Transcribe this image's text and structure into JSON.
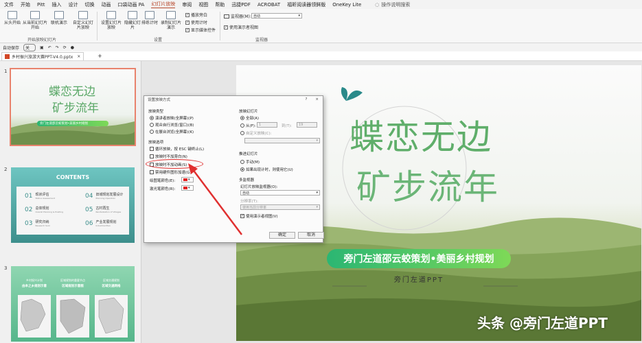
{
  "menu": {
    "items": [
      "文件",
      "开始",
      "Pitt",
      "插入",
      "设计",
      "切换",
      "动画",
      "口袋动画 PA",
      "幻灯片放映",
      "审阅",
      "视图",
      "帮助",
      "迅捷PDF",
      "ACROBAT",
      "福昕阅读器领鲜版",
      "OneKey Lite"
    ],
    "active_index": 8,
    "search": "操作说明搜索"
  },
  "ribbon": {
    "buttons": [
      "从头开始",
      "从当前幻灯片开始",
      "联机演示",
      "自定义幻灯片放映",
      "设置幻灯片放映",
      "隐藏幻灯片",
      "排练计时",
      "录制幻灯片演示"
    ],
    "groups": [
      "开始放映幻灯片",
      "设置",
      "监视器"
    ],
    "checks": [
      "播放旁白",
      "使用计时",
      "显示媒体控件"
    ],
    "monitor_label": "监视器(M):",
    "monitor_value": "自动",
    "presenter_view": "使用演示者视图"
  },
  "qat": {
    "autosave": "自动保存",
    "state": "关"
  },
  "file_tab": {
    "name": "乡村振兴旅游大赛PPT-V4.0.pptx"
  },
  "thumbs": {
    "numbers": [
      "1",
      "2",
      "3"
    ],
    "s1": {
      "title1": "蝶恋无边",
      "title2": "矿步流年",
      "banner": "旁门左道邵云蛟策划•美丽乡村规划"
    },
    "s2": {
      "title": "CONTENTS",
      "items": [
        {
          "num": "01",
          "label": "现状评估",
          "sub": "Status Assessment"
        },
        {
          "num": "02",
          "label": "总体规划",
          "sub": "Overall Planning & Positing"
        },
        {
          "num": "03",
          "label": "研究归纳",
          "sub": "Research Sum"
        },
        {
          "num": "04",
          "label": "旧城规划发展设计",
          "sub": "Planning Operation"
        },
        {
          "num": "05",
          "label": "古村再生",
          "sub": "Revitalization of Villages"
        },
        {
          "num": "06",
          "label": "产业发展规划",
          "sub": "Industrial Plan"
        }
      ]
    },
    "s3": {
      "headers": [
        "乡村振兴计划",
        "区域规划的重要节点",
        "区域交通规划"
      ],
      "subheaders": [
        "由本之乡规划示意",
        "区域规划示意图",
        "区域交通网络"
      ]
    }
  },
  "slide": {
    "title1": "蝶恋无边",
    "title2": "矿步流年",
    "banner": "旁门左道邵云蛟策划•美丽乡村规划",
    "subtitle": "旁门左道PPT"
  },
  "dialog": {
    "title": "设置放映方式",
    "help": "?",
    "close": "×",
    "show_type_label": "放映类型",
    "show_types": [
      "演讲者放映(全屏幕)(P)",
      "观众自行浏览(窗口)(B)",
      "在展台浏览(全屏幕)(K)"
    ],
    "options_label": "放映选项",
    "options": [
      "循环放映，按 ESC 键终止(L)",
      "放映时不加旁白(N)",
      "放映时不加动画(S)",
      "禁用硬件图形加速(G)"
    ],
    "pen_color_label": "绘图笔颜色(E):",
    "laser_color_label": "激光笔颜色(R):",
    "slides_label": "放映幻灯片",
    "all": "全部(A)",
    "from": "从(F):",
    "from_value": "1",
    "to": "到(T):",
    "to_value": "19",
    "custom_show": "自定义放映(C):",
    "advance_label": "推进幻灯片",
    "manual": "手动(M)",
    "timings": "如果出现计时，则使用它(U)",
    "multi_monitor_label": "多监视器",
    "monitor_label": "幻灯片放映监视器(O):",
    "monitor_value": "自动",
    "resolution_label": "分辨率(T):",
    "resolution_value": "使用当前分辨率",
    "presenter_view": "使用演示者视图(V)",
    "ok": "确定",
    "cancel": "取消"
  },
  "watermark": "头条 @旁门左道PPT",
  "colors": {
    "accent": "#b7472a",
    "annotation": "#e03030",
    "banner_start": "#2bb673",
    "banner_end": "#7ed957"
  }
}
